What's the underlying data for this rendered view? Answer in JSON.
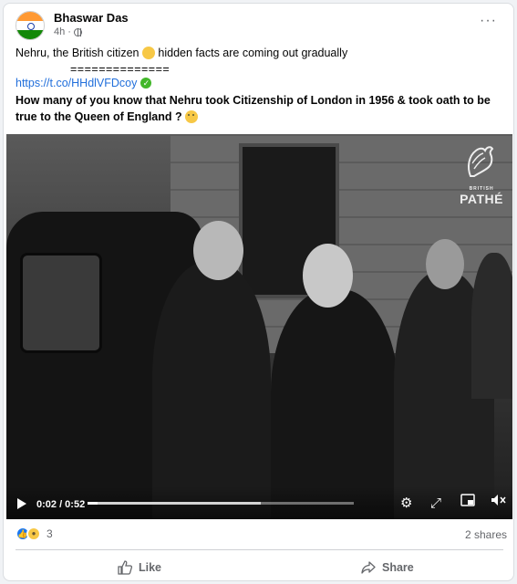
{
  "post": {
    "author": "Bhaswar Das",
    "time": "4h",
    "more": "···",
    "line1_before": "Nehru, the British citizen ",
    "line1_after": " hidden facts are coming out gradually",
    "separator": "==============",
    "link": "https://t.co/HHdlVFDcoy",
    "bold_text": "How many of you know that Nehru took Citizenship of London in 1956 & took oath to be true to the Queen of England ?"
  },
  "video": {
    "watermark_small": "BRITISH",
    "watermark_brand": "PATHÉ",
    "time_display": "0:02 / 0:52",
    "progress": 0.038,
    "buffered": 0.65,
    "icons": [
      "play-icon",
      "settings-icon",
      "expand-icon",
      "pip-icon",
      "mute-icon"
    ]
  },
  "footer": {
    "reaction_count": "3",
    "shares": "2 shares",
    "like_label": "Like",
    "share_label": "Share"
  },
  "colors": {
    "link": "#216fdb",
    "like_blue": "#1877f2",
    "muted": "#65676b"
  }
}
